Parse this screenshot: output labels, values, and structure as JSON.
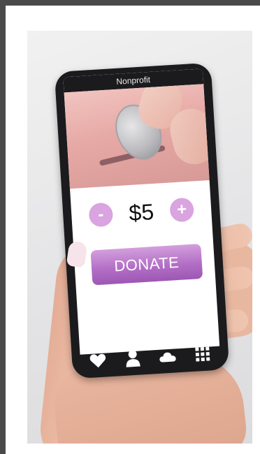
{
  "app": {
    "title": "Nonprofit"
  },
  "donation": {
    "minus_label": "-",
    "amount": "$5",
    "plus_label": "+",
    "donate_label": "DONATE"
  },
  "nav": {
    "items": [
      {
        "icon": "heart-icon"
      },
      {
        "icon": "person-icon"
      },
      {
        "icon": "cloud-icon"
      },
      {
        "icon": "grid-icon"
      }
    ]
  },
  "colors": {
    "accent": "#b36fc6",
    "circle_button": "#d9a4df",
    "phone_body": "#1b1b1d"
  }
}
